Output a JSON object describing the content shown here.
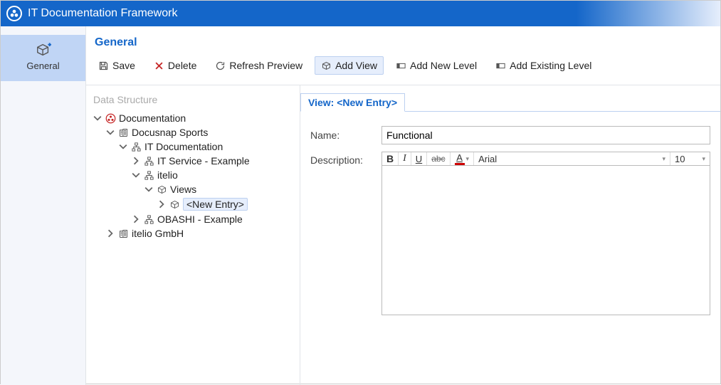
{
  "title": "IT Documentation Framework",
  "sidebar": {
    "general_label": "General"
  },
  "section_header": "General",
  "toolbar": {
    "save": "Save",
    "delete": "Delete",
    "refresh": "Refresh Preview",
    "add_view": "Add View",
    "add_new_level": "Add New Level",
    "add_existing_level": "Add Existing Level"
  },
  "tree": {
    "title": "Data Structure",
    "documentation": "Documentation",
    "docusnap_sports": "Docusnap Sports",
    "it_documentation": "IT Documentation",
    "it_service_example": "IT Service - Example",
    "itelio": "itelio",
    "views": "Views",
    "new_entry": "<New Entry>",
    "obashi_example": "OBASHI - Example",
    "itelio_gmbh": "itelio GmbH"
  },
  "panel": {
    "tab_label": "View: <New Entry>",
    "name_label": "Name:",
    "name_value": "Functional",
    "description_label": "Description:",
    "rte": {
      "bold": "B",
      "italic": "I",
      "underline": "U",
      "strike": "abc",
      "color_letter": "A",
      "font": "Arial",
      "size": "10"
    }
  }
}
